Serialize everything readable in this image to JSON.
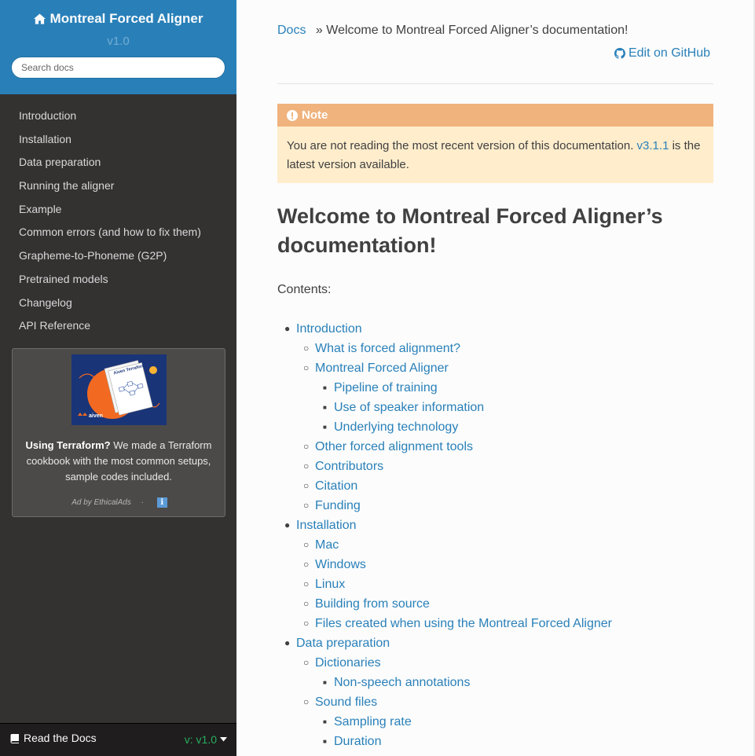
{
  "sidebar": {
    "project_title": "Montreal Forced Aligner",
    "version": "v1.0",
    "search_placeholder": "Search docs",
    "nav_items": [
      {
        "label": "Introduction"
      },
      {
        "label": "Installation"
      },
      {
        "label": "Data preparation"
      },
      {
        "label": "Running the aligner"
      },
      {
        "label": "Example"
      },
      {
        "label": "Common errors (and how to fix them)"
      },
      {
        "label": "Grapheme-to-Phoneme (G2P)"
      },
      {
        "label": "Pretrained models"
      },
      {
        "label": "Changelog"
      },
      {
        "label": "API Reference"
      }
    ],
    "ad": {
      "image_title": "Aiven Terraform Cookbook",
      "image_brand": "aiven",
      "text_bold": "Using Terraform?",
      "text_rest": " We made a Terraform cookbook with the most common setups, sample codes included.",
      "footer": "Ad by EthicalAds",
      "separator": "·",
      "info_icon": "i"
    },
    "versions_bar": {
      "label": "Read the Docs",
      "current": "v: v1.0"
    }
  },
  "content": {
    "breadcrumb": {
      "root": "Docs",
      "separator": "»",
      "current": "Welcome to Montreal Forced Aligner’s documentation!"
    },
    "edit_link": "Edit on GitHub",
    "note": {
      "title": "Note",
      "text_before": "You are not reading the most recent version of this documentation. ",
      "link": "v3.1.1",
      "text_after": " is the latest version available."
    },
    "title": "Welcome to Montreal Forced Aligner’s documentation!",
    "contents_label": "Contents:",
    "toc": [
      {
        "label": "Introduction",
        "level": 1
      },
      {
        "label": "What is forced alignment?",
        "level": 2
      },
      {
        "label": "Montreal Forced Aligner",
        "level": 2
      },
      {
        "label": "Pipeline of training",
        "level": 3
      },
      {
        "label": "Use of speaker information",
        "level": 3
      },
      {
        "label": "Underlying technology",
        "level": 3
      },
      {
        "label": "Other forced alignment tools",
        "level": 2
      },
      {
        "label": "Contributors",
        "level": 2
      },
      {
        "label": "Citation",
        "level": 2
      },
      {
        "label": "Funding",
        "level": 2
      },
      {
        "label": "Installation",
        "level": 1
      },
      {
        "label": "Mac",
        "level": 2
      },
      {
        "label": "Windows",
        "level": 2
      },
      {
        "label": "Linux",
        "level": 2
      },
      {
        "label": "Building from source",
        "level": 2
      },
      {
        "label": "Files created when using the Montreal Forced Aligner",
        "level": 2
      },
      {
        "label": "Data preparation",
        "level": 1
      },
      {
        "label": "Dictionaries",
        "level": 2
      },
      {
        "label": "Non-speech annotations",
        "level": 3
      },
      {
        "label": "Sound files",
        "level": 2
      },
      {
        "label": "Sampling rate",
        "level": 3
      },
      {
        "label": "Duration",
        "level": 3
      }
    ]
  },
  "icons": {
    "project": "home-icon",
    "edit": "github-icon",
    "note": "exclamation-circle-icon",
    "versions": "book-icon",
    "versions_toggle": "caret-down-icon"
  },
  "colors": {
    "accent": "#2980b9",
    "sidebar_bg": "#343131",
    "note_title_bg": "#f0b37e",
    "note_bg": "#ffedcc",
    "version_green": "#27ae60"
  }
}
